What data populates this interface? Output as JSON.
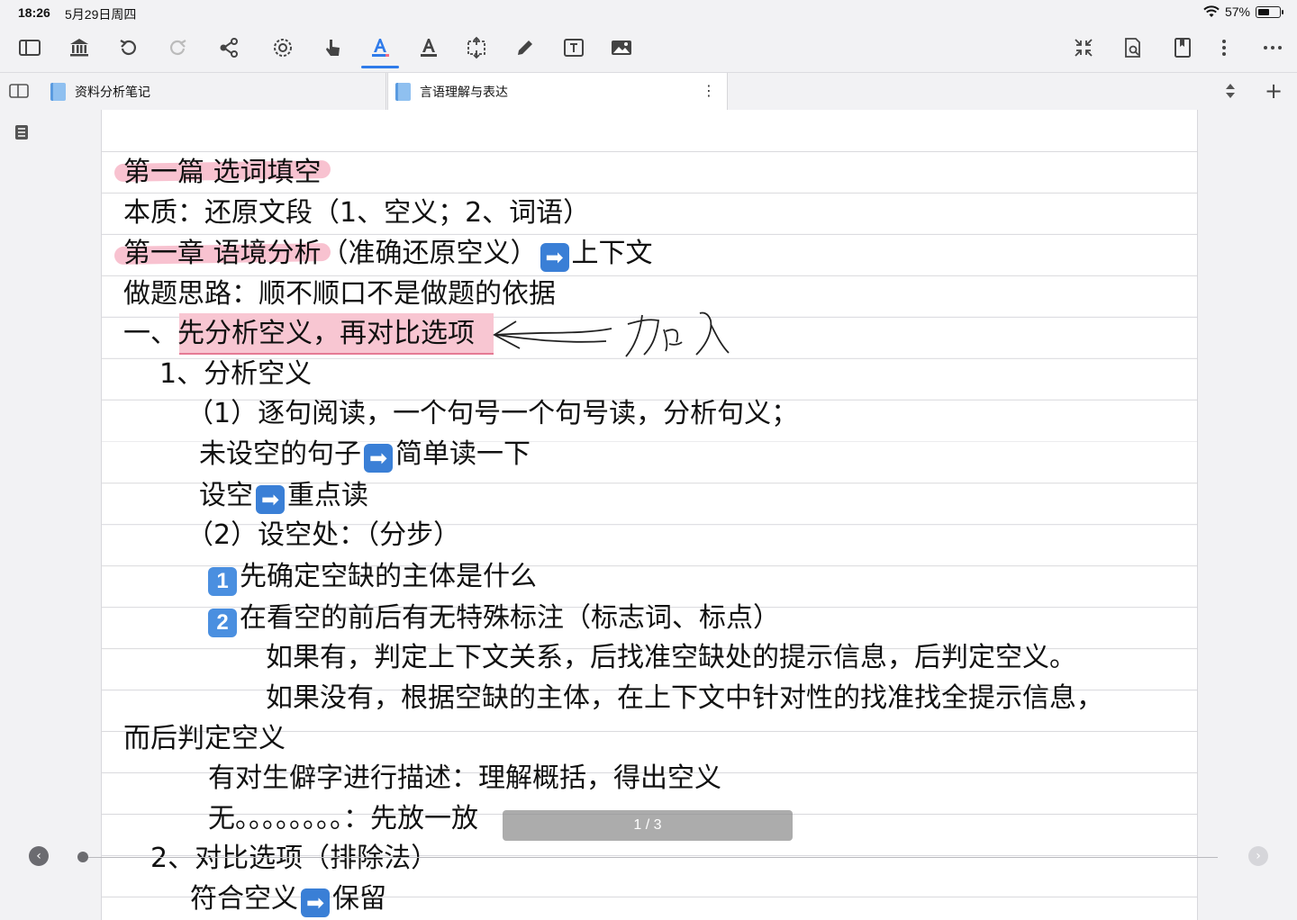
{
  "status_bar": {
    "time": "18:26",
    "date": "5月29日周四",
    "battery_percent": "57%",
    "battery_level": 0.57
  },
  "toolbar": {
    "left_icons": [
      "sidebar-icon",
      "library-icon",
      "undo-icon",
      "redo-icon",
      "share-icon",
      "lasso-icon",
      "hand-pointer-icon",
      "highlighter-text-icon",
      "text-color-icon",
      "resize-icon",
      "pen-icon",
      "textbox-icon",
      "image-icon"
    ],
    "right_icons": [
      "collapse-icon",
      "search-document-icon",
      "bookmark-icon",
      "more-vertical-icon",
      "more-horizontal-icon"
    ],
    "active_tool": "highlighter-text-icon",
    "accent_color": "#2f7bea"
  },
  "tabs": [
    {
      "label": "资料分析笔记"
    },
    {
      "label": "言语理解与表达"
    }
  ],
  "note": {
    "lines": [
      {
        "text": "第一篇 选词填空"
      },
      {
        "text": "本质：还原文段（1、空义；2、词语）"
      },
      {
        "pre": "第一章 语境分析（准确还原空义）",
        "arrow": "➡",
        "post": "上下文"
      },
      {
        "text": "做题思路：顺不顺口不是做题的依据"
      },
      {
        "pre": "一、",
        "highlight": "先分析空义，再对比选项"
      },
      {
        "text": "1、分析空义"
      },
      {
        "text": "（1）逐句阅读，一个句号一个句号读，分析句义；"
      },
      {
        "pre": "未设空的句子",
        "arrow": "➡",
        "post": "简单读一下"
      },
      {
        "pre": "设空",
        "arrow": "➡",
        "post": "重点读"
      },
      {
        "text": "（2）设空处：（分步）"
      },
      {
        "num": "1",
        "text": "先确定空缺的主体是什么"
      },
      {
        "num": "2",
        "text": "在看空的前后有无特殊标注（标志词、标点）"
      },
      {
        "text": "如果有，判定上下文关系，后找准空缺处的提示信息，后判定空义。"
      },
      {
        "text": "如果没有，根据空缺的主体，在上下文中针对性的找准找全提示信息，"
      },
      {
        "text": "而后判定空义"
      },
      {
        "text": "有对生僻字进行描述：理解概括，得出空义"
      },
      {
        "text": "无。。。。。。。。：先放一放"
      },
      {
        "text": "2、对比选项（排除法）"
      },
      {
        "pre": "符合空义",
        "arrow": "➡",
        "post": "保留"
      }
    ],
    "handwriting": "加入",
    "highlight_color": "#f8c6d2"
  },
  "pager": {
    "label": "1 / 3"
  }
}
